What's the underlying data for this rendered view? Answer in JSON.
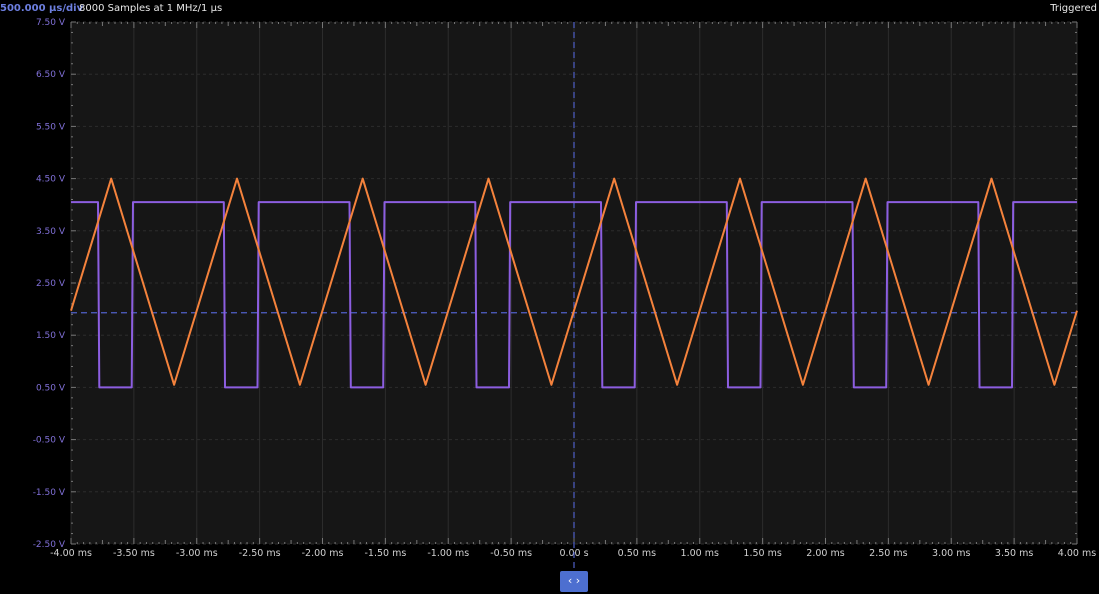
{
  "header": {
    "timebase": "500.000 µs/div",
    "samples": "8000 Samples at 1 MHz/1 µs",
    "status": "Triggered"
  },
  "pan_button": {
    "label": "‹ ›",
    "icon": "chevron-left-right-icon"
  },
  "colors": {
    "background": "#000000",
    "plot_background": "#161616",
    "grid": "#2c2c2c",
    "cursor": "#5060c8",
    "channel_square": "#8c5ee0",
    "channel_triangle": "#f4823c"
  },
  "chart_data": {
    "type": "line",
    "xlim": [
      -4.0,
      4.0
    ],
    "ylim": [
      -2.5,
      7.5
    ],
    "x_unit": "ms",
    "y_unit": "V",
    "grid": true,
    "x_ticks": [
      "-4.00 ms",
      "-3.50 ms",
      "-3.00 ms",
      "-2.50 ms",
      "-2.00 ms",
      "-1.50 ms",
      "-1.00 ms",
      "-0.50 ms",
      "0.00 s",
      "0.50 ms",
      "1.00 ms",
      "1.50 ms",
      "2.00 ms",
      "2.50 ms",
      "3.00 ms",
      "3.50 ms",
      "4.00 ms"
    ],
    "y_ticks": [
      "7.50 V",
      "6.50 V",
      "5.50 V",
      "4.50 V",
      "3.50 V",
      "2.50 V",
      "1.50 V",
      "0.50 V",
      "-0.50 V",
      "-1.50 V",
      "-2.50 V"
    ],
    "trigger_time": 0.0,
    "trigger_level": 1.93,
    "series": [
      {
        "color": "#8c5ee0",
        "waveform": "square",
        "period_ms": 1.0,
        "high_v": 4.05,
        "low_v": 0.5,
        "falling_edges_ms": [
          -3.785,
          -2.785,
          -1.785,
          -0.785,
          0.215,
          1.215,
          2.215,
          3.215
        ],
        "rising_edges_ms": [
          -3.517,
          -2.517,
          -1.517,
          -0.517,
          0.483,
          1.483,
          2.483,
          3.483
        ]
      },
      {
        "color": "#f4823c",
        "waveform": "triangle",
        "period_ms": 1.0,
        "points": [
          [
            -4.0,
            1.97
          ],
          [
            -3.68,
            4.5
          ],
          [
            -3.18,
            0.55
          ],
          [
            -2.68,
            4.5
          ],
          [
            -2.18,
            0.55
          ],
          [
            -1.68,
            4.5
          ],
          [
            -1.18,
            0.55
          ],
          [
            -0.68,
            4.5
          ],
          [
            -0.18,
            0.55
          ],
          [
            0.32,
            4.5
          ],
          [
            0.82,
            0.55
          ],
          [
            1.32,
            4.5
          ],
          [
            1.82,
            0.55
          ],
          [
            2.32,
            4.5
          ],
          [
            2.82,
            0.55
          ],
          [
            3.32,
            4.5
          ],
          [
            3.82,
            0.55
          ],
          [
            4.0,
            1.97
          ]
        ]
      }
    ]
  }
}
